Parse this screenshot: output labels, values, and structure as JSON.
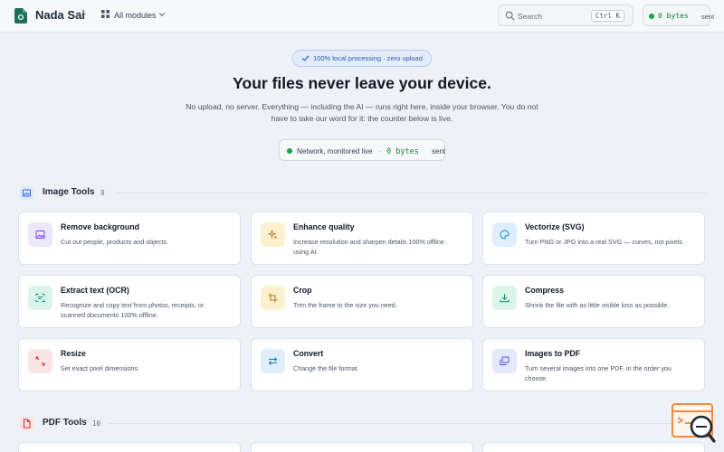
{
  "header": {
    "brand": "Nada Sai",
    "crumb_separator": "›",
    "modules_label": "All modules",
    "search_placeholder": "Search",
    "search_shortcut": "Ctrl K",
    "net_bytes": "0 bytes",
    "net_unit": "sent"
  },
  "hero": {
    "badge": "100% local processing · zero upload",
    "title": "Your files never leave your device.",
    "subtitle": "No upload, no server. Everything — including the AI — runs right here, inside your browser. You do not have to take our word for it: the counter below is live.",
    "monitor_label": "Network, monitored live",
    "monitor_sep": "·",
    "monitor_bytes": "0 bytes",
    "monitor_unit": "sent"
  },
  "image_tools": {
    "title": "Image Tools",
    "count": "9",
    "cards": [
      {
        "title": "Remove background",
        "desc": "Cut out people, products and objects.",
        "icon": "image-icon",
        "color": "purple"
      },
      {
        "title": "Enhance quality",
        "desc": "Increase resolution and sharpen details 100% offline using AI.",
        "icon": "sparkles-icon",
        "color": "yellow"
      },
      {
        "title": "Vectorize (SVG)",
        "desc": "Turn PNG or JPG into a real SVG — curves, not pixels.",
        "icon": "palette-icon",
        "color": "blue"
      },
      {
        "title": "Extract text (OCR)",
        "desc": "Recognize and copy text from photos, receipts, or scanned documents 100% offline.",
        "icon": "scan-text-icon",
        "color": "green"
      },
      {
        "title": "Crop",
        "desc": "Trim the frame to the size you need.",
        "icon": "crop-icon",
        "color": "yellow"
      },
      {
        "title": "Compress",
        "desc": "Shrink the file with as little visible loss as possible.",
        "icon": "download-icon",
        "color": "green"
      },
      {
        "title": "Resize",
        "desc": "Set exact pixel dimensions.",
        "icon": "resize-arrows-icon",
        "color": "red"
      },
      {
        "title": "Convert",
        "desc": "Change the file format.",
        "icon": "swap-arrows-icon",
        "color": "blue"
      },
      {
        "title": "Images to PDF",
        "desc": "Turn several images into one PDF, in the order you choose.",
        "icon": "images-stack-icon",
        "color": "indigo"
      }
    ]
  },
  "pdf_tools": {
    "title": "PDF Tools",
    "count": "10"
  },
  "colors": {
    "accent_green": "#16a34a",
    "pill_blue": "#2f5fa8",
    "pdf_red": "#dc2626",
    "image_blue": "#3b82f6"
  }
}
